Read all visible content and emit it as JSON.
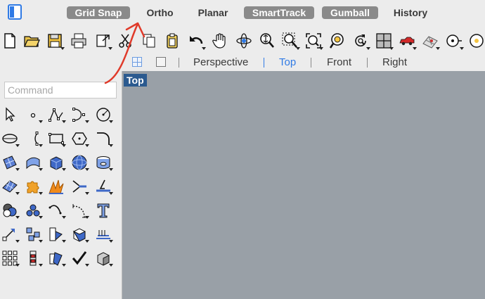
{
  "statusbar": {
    "snaps": [
      {
        "label": "Grid Snap",
        "on": true
      },
      {
        "label": "Ortho",
        "on": false
      },
      {
        "label": "Planar",
        "on": false
      },
      {
        "label": "SmartTrack",
        "on": true
      },
      {
        "label": "Gumball",
        "on": true
      },
      {
        "label": "History",
        "on": false
      }
    ],
    "panel_icon": "sidebar-toggle-icon"
  },
  "toolbar": {
    "icons": [
      "new-file-icon",
      "open-folder-icon",
      "save-icon",
      "print-icon",
      "export-icon",
      "cut-icon",
      "copy-icon",
      "paste-icon",
      "undo-icon",
      "pan-hand-icon",
      "rotate-view-icon",
      "zoom-dynamic-icon",
      "zoom-window-icon",
      "zoom-extents-icon",
      "zoom-selected-icon",
      "undo-view-icon",
      "four-viewports-icon",
      "car-render-icon",
      "grid-options-icon",
      "osnap-icon",
      "options-icon"
    ]
  },
  "viewport_tabs": {
    "tabs": [
      "Perspective",
      "Top",
      "Front",
      "Right"
    ],
    "active": "Top"
  },
  "command": {
    "placeholder": "Command"
  },
  "tools": {
    "icons": [
      "select-arrow-icon",
      "point-icon",
      "polyline-icon",
      "curve-icon",
      "circle-icon",
      "ellipse-icon",
      "arc-icon",
      "rectangle-icon",
      "polygon-icon",
      "fillet-icon",
      "surface-patch-icon",
      "surface-sweep-icon",
      "box-solid-icon",
      "sphere-icon",
      "mesh-icon",
      "surface-grid-icon",
      "puzzle-icon",
      "explode-icon",
      "trim-icon",
      "split-icon",
      "boolean-icon",
      "group-icon",
      "rebuild-curve-icon",
      "dimension-icon",
      "text-icon",
      "transform-icon",
      "array-icon",
      "align-icon",
      "extrude-icon",
      "section-icon",
      "grid-array-icon",
      "point-edit-icon",
      "mirror-icon",
      "check-icon",
      "render-shade-icon"
    ]
  },
  "viewport": {
    "label": "Top",
    "bg": "#99a0a7"
  },
  "colors": {
    "accent": "#2f7ae5",
    "snap_on": "#8a8a8a",
    "viewport_label_bg": "#2b5a8f",
    "annotation": "#e03a2a"
  }
}
